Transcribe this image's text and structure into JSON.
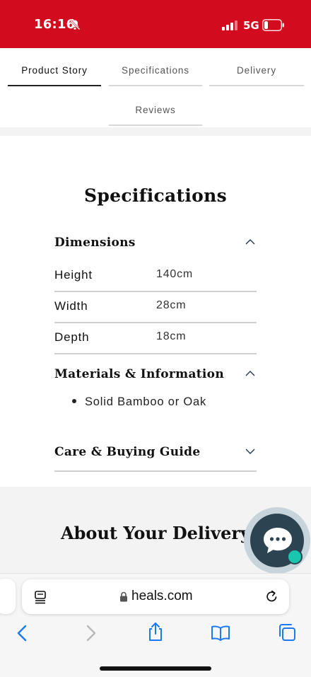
{
  "status_bar": {
    "time": "16:16",
    "network": "5G",
    "background_color": "#d30b1e",
    "icons": [
      "bell-slash-icon",
      "signal-icon",
      "battery-icon"
    ]
  },
  "tabs": [
    {
      "label": "Product Story",
      "active": true
    },
    {
      "label": "Specifications",
      "active": false
    },
    {
      "label": "Delivery",
      "active": false
    },
    {
      "label": "Reviews",
      "active": false
    }
  ],
  "specifications": {
    "title": "Specifications",
    "dimensions": {
      "title": "Dimensions",
      "expanded": true,
      "rows": [
        {
          "label": "Height",
          "value": "140cm"
        },
        {
          "label": "Width",
          "value": "28cm"
        },
        {
          "label": "Depth",
          "value": "18cm"
        }
      ]
    },
    "materials": {
      "title": "Materials & Information",
      "expanded": true,
      "items": [
        "Solid Bamboo or Oak"
      ]
    },
    "care": {
      "title": "Care & Buying Guide",
      "expanded": false
    }
  },
  "delivery": {
    "title": "About Your Delivery"
  },
  "chat": {
    "icon": "chat-bubble-icon",
    "status_color": "#18c7ad"
  },
  "browser": {
    "url": "heals.com",
    "icons": [
      "reader-mode-icon",
      "lock-icon",
      "reload-icon",
      "back-icon",
      "forward-icon",
      "share-icon",
      "bookmarks-icon",
      "tabs-icon"
    ]
  }
}
